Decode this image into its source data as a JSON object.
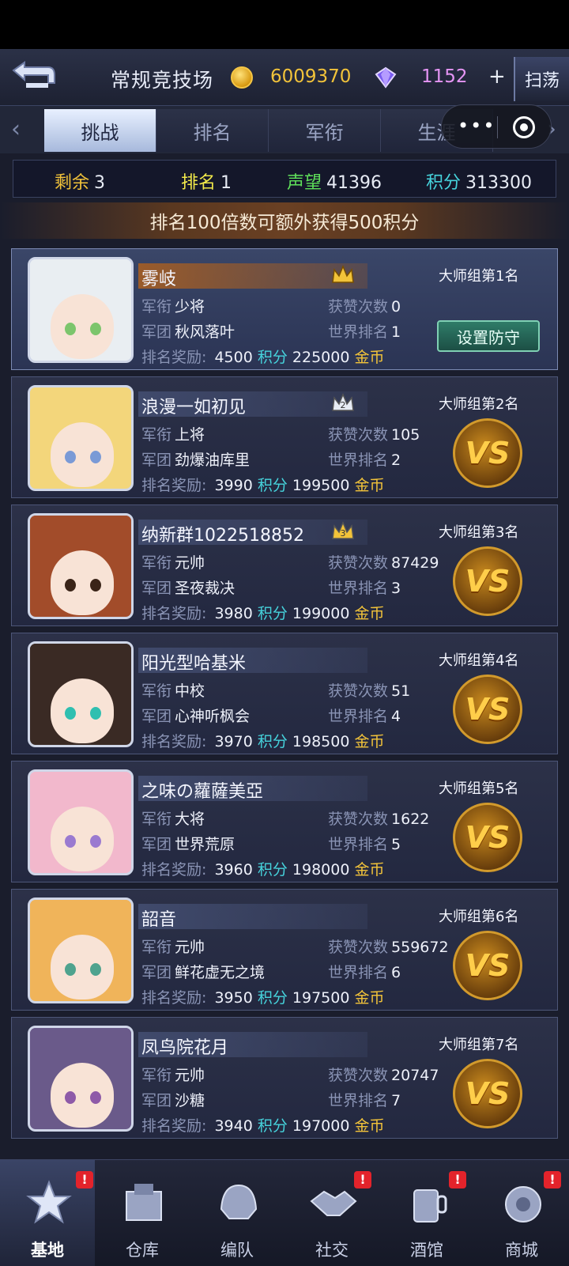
{
  "header": {
    "title": "常规竞技场",
    "gold": "6009370",
    "gems": "1152",
    "plus": "+",
    "sweep": "扫荡"
  },
  "tabs": [
    {
      "label": "挑战",
      "active": true
    },
    {
      "label": "排名",
      "active": false
    },
    {
      "label": "军衔",
      "active": false
    },
    {
      "label": "生涯",
      "active": false
    }
  ],
  "stats": {
    "remain_label": "剩余",
    "remain": "3",
    "rank_label": "排名",
    "rank": "1",
    "fame_label": "声望",
    "fame": "41396",
    "points_label": "积分",
    "points": "313300"
  },
  "banner": "排名100倍数可额外获得500积分",
  "labels": {
    "rank_title": "军衔",
    "legion": "军团",
    "likes": "获赞次数",
    "world_rank": "世界排名",
    "reward": "排名奖励:",
    "pts": "积分",
    "gold": "金币",
    "vs": "VS",
    "defend": "设置防守"
  },
  "players": [
    {
      "name": "雾岐",
      "rank_title": "少将",
      "legion": "秋风落叶",
      "likes": "0",
      "world_rank": "1",
      "reward_pts": "4500",
      "reward_gold": "225000",
      "group": "大师组第1名",
      "crown": "",
      "hair": "#e9eef2",
      "eye": "#7cc56c"
    },
    {
      "name": "浪漫一如初见",
      "rank_title": "上将",
      "legion": "劲爆油库里",
      "likes": "105",
      "world_rank": "2",
      "reward_pts": "3990",
      "reward_gold": "199500",
      "group": "大师组第2名",
      "crown": "2",
      "hair": "#f3d67b",
      "eye": "#7a9ad6"
    },
    {
      "name": "纳新群1022518852",
      "rank_title": "元帅",
      "legion": "圣夜裁决",
      "likes": "87429",
      "world_rank": "3",
      "reward_pts": "3980",
      "reward_gold": "199000",
      "group": "大师组第3名",
      "crown": "3",
      "hair": "#a24c2a",
      "eye": "#3a2418"
    },
    {
      "name": "阳光型哈基米",
      "rank_title": "中校",
      "legion": "心神听枫会",
      "likes": "51",
      "world_rank": "4",
      "reward_pts": "3970",
      "reward_gold": "198500",
      "group": "大师组第4名",
      "crown": "",
      "hair": "#3a2a24",
      "eye": "#2fbfb0"
    },
    {
      "name": "之味の蘿薩美亞",
      "rank_title": "大将",
      "legion": "世界荒原",
      "likes": "1622",
      "world_rank": "5",
      "reward_pts": "3960",
      "reward_gold": "198000",
      "group": "大师组第5名",
      "crown": "",
      "hair": "#f2b8cc",
      "eye": "#9a7ad0"
    },
    {
      "name": "韶音",
      "rank_title": "元帅",
      "legion": "鲜花虚无之境",
      "likes": "559672",
      "world_rank": "6",
      "reward_pts": "3950",
      "reward_gold": "197500",
      "group": "大师组第6名",
      "crown": "",
      "hair": "#f0b45a",
      "eye": "#4fa38e"
    },
    {
      "name": "凤鸟院花月",
      "rank_title": "元帅",
      "legion": "沙糖",
      "likes": "20747",
      "world_rank": "7",
      "reward_pts": "3940",
      "reward_gold": "197000",
      "group": "大师组第7名",
      "crown": "",
      "hair": "#6a5a8a",
      "eye": "#8e5aa8"
    }
  ],
  "nav": [
    {
      "label": "基地",
      "icon": "star-badge-icon",
      "active": true,
      "alert": true
    },
    {
      "label": "仓库",
      "icon": "warehouse-icon",
      "active": false,
      "alert": false
    },
    {
      "label": "编队",
      "icon": "helmet-icon",
      "active": false,
      "alert": false
    },
    {
      "label": "社交",
      "icon": "handshake-icon",
      "active": false,
      "alert": true
    },
    {
      "label": "酒馆",
      "icon": "tavern-icon",
      "active": false,
      "alert": true
    },
    {
      "label": "商城",
      "icon": "shop-icon",
      "active": false,
      "alert": true
    }
  ],
  "alert_mark": "!",
  "colors": {
    "gold": "#f2c33a",
    "gem": "#e595f4",
    "remain": "#f2c33a",
    "rank": "#f2e94a",
    "fame": "#5fe05a",
    "points": "#46d3dc"
  }
}
